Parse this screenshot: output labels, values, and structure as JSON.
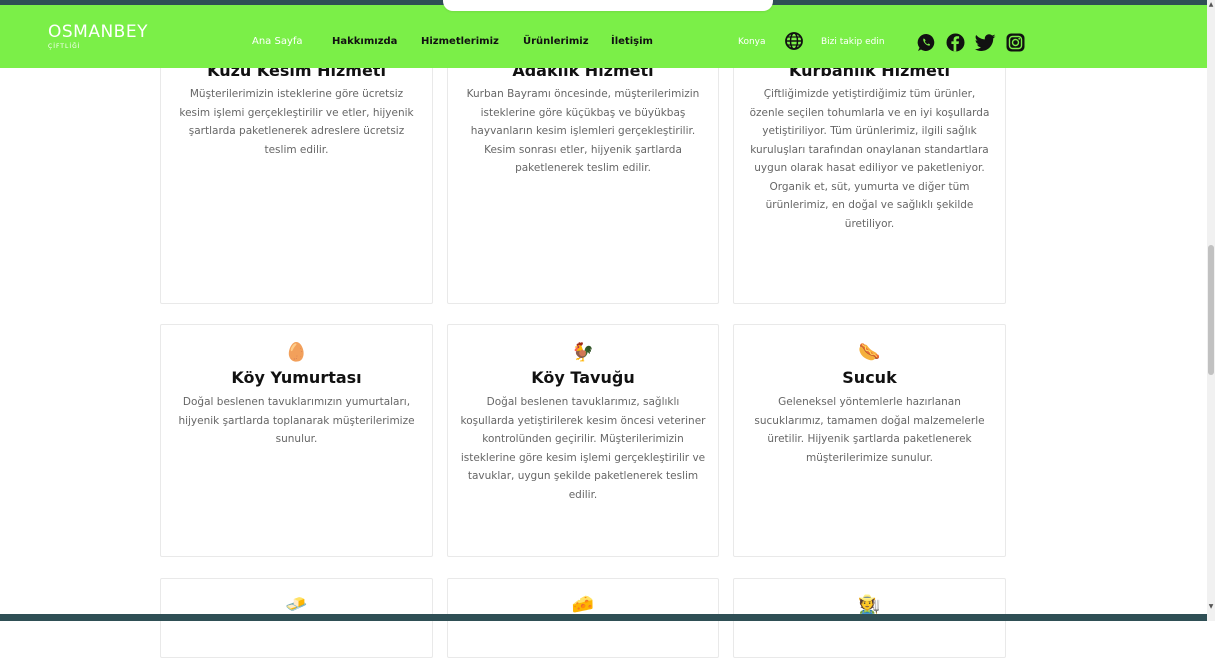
{
  "brand": {
    "name": "OSMANBEY",
    "tagline": "ÇİFTLİĞİ"
  },
  "nav": {
    "items": [
      {
        "label": "Ana Sayfa"
      },
      {
        "label": "Hakkımızda"
      },
      {
        "label": "Hizmetlerimiz"
      },
      {
        "label": "Ürünlerimiz"
      },
      {
        "label": "İletişim"
      }
    ],
    "location": "Konya",
    "follow": "Bizi takip edin"
  },
  "icons": [
    "globe-icon",
    "whatsapp-icon",
    "facebook-icon",
    "twitter-icon",
    "instagram-icon"
  ],
  "services": [
    {
      "title": "Kuzu Kesim Hizmeti",
      "desc": "Müşterilerimizin isteklerine göre ücretsiz kesim işlemi gerçekleştirilir ve etler, hijyenik şartlarda paketlenerek adreslere ücretsiz teslim edilir."
    },
    {
      "title": "Adaklık Hizmeti",
      "desc": "Kurban Bayramı öncesinde, müşterilerimizin isteklerine göre küçükbaş ve büyükbaş hayvanların kesim işlemleri gerçekleştirilir. Kesim sonrası etler, hijyenik şartlarda paketlenerek teslim edilir."
    },
    {
      "title": "Kurbanlık Hizmeti",
      "desc": "Çiftliğimizde yetiştirdiğimiz tüm ürünler, özenle seçilen tohumlarla ve en iyi koşullarda yetiştiriliyor. Tüm ürünlerimiz, ilgili sağlık kuruluşları tarafından onaylanan standartlara uygun olarak hasat ediliyor ve paketleniyor. Organik et, süt, yumurta ve diğer tüm ürünlerimiz, en doğal ve sağlıklı şekilde üretiliyor."
    }
  ],
  "products": [
    {
      "title": "Köy Yumurtası",
      "icon": "🥚",
      "desc": "Doğal beslenen tavuklarımızın yumurtaları, hijyenik şartlarda toplanarak müşterilerimize sunulur."
    },
    {
      "title": "Köy Tavuğu",
      "icon": "🐓",
      "desc": "Doğal beslenen tavuklarımız, sağlıklı koşullarda yetiştirilerek kesim öncesi veteriner kontrolünden geçirilir. Müşterilerimizin isteklerine göre kesim işlemi gerçekleştirilir ve tavuklar, uygun şekilde paketlenerek teslim edilir."
    },
    {
      "title": "Sucuk",
      "icon": "🌭",
      "desc": "Geleneksel yöntemlerle hazırlanan sucuklarımız, tamamen doğal malzemelerle üretilir. Hijyenik şartlarda paketlenerek müşterilerimize sunulur."
    }
  ],
  "next_row_icons": [
    "🧈",
    "🧀",
    "🧑‍🌾"
  ]
}
